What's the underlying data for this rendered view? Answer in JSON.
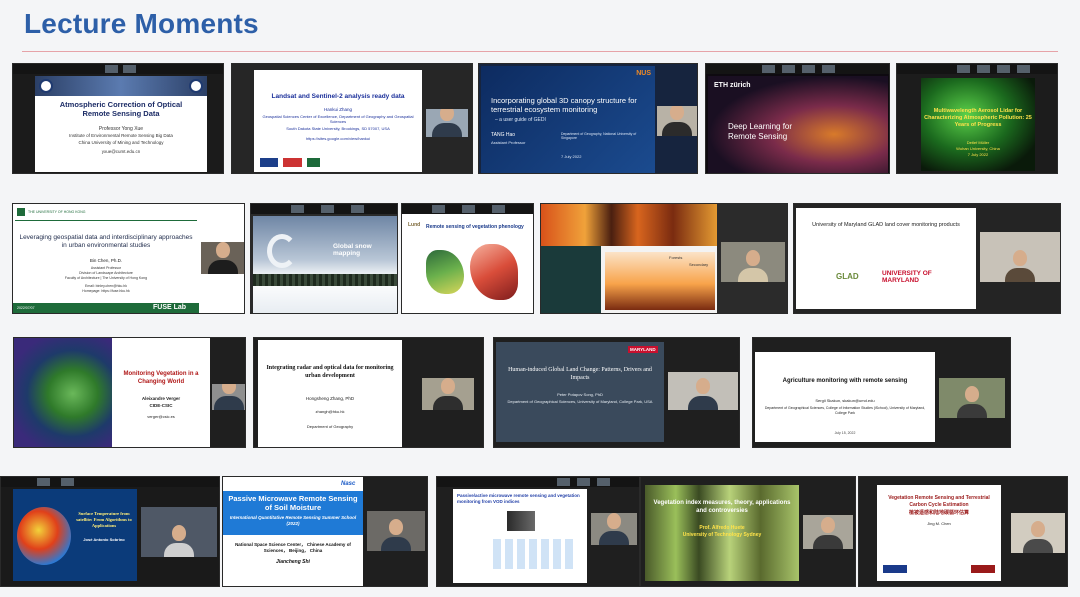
{
  "page": {
    "title": "Lecture Moments"
  },
  "row1": {
    "t1": {
      "title": "Atmospheric Correction of Optical Remote Sensing Data",
      "speaker": "Professor Yong Xue",
      "affiliation": "Institute of Environmental Remote Sensing Big Data",
      "institution": "China University of Mining and Technology",
      "email": "yxue@cumt.edu.cn"
    },
    "t2": {
      "title": "Landsat and Sentinel-2 analysis ready data",
      "speaker": "Hankui Zhang",
      "affiliation": "Geospatial Sciences Center of Excellence, Department of Geography and Geospatial Sciences",
      "institution": "South Dakota State University, Brookings, SD 57007, USA",
      "url": "https://sites.google.com/view/hankui"
    },
    "t3": {
      "logo": "NUS",
      "title": "Incorporating global 3D canopy structure for terrestrial ecosystem monitoring",
      "subtitle": "– a user guide of GEDI",
      "speaker": "TANG Hao",
      "role": "Assistant Professor",
      "affiliation": "Department of Geography, National University of Singapore",
      "date": "7 July 2022"
    },
    "t4": {
      "logo": "ETH zürich",
      "title": "Deep Learning for Remote Sensing"
    },
    "t5": {
      "title": "Multiwavelength Aerosol Lidar for Characterizing Atmospheric Pollution: 25 Years of Progress",
      "speaker": "Detlef Müller",
      "institution": "Wuhan University, China",
      "date": "7 July 2022"
    }
  },
  "row2": {
    "t1": {
      "university": "THE UNIVERSITY OF HONG KONG",
      "title": "Leveraging geospatial data and interdisciplinary approaches in urban environmental studies",
      "speaker": "Bin Chen, Ph.D.",
      "role": "Assistant Professor",
      "affiliation": "Division of Landscape Architecture",
      "faculty": "Faculty of Architecture | The University of Hong Kong",
      "email": "Email: binley.chen@hku.hk",
      "homepage": "Homepage: https://fuse.hku.hk",
      "lab": "FUSE Lab",
      "date": "2022/07/07"
    },
    "t2": {
      "title": "Global snow mapping"
    },
    "t3": {
      "title": "Remote sensing of vegetation phenology",
      "logo": "Lund"
    },
    "t4": {
      "label_left": "Forests",
      "label_right": "Secondary"
    },
    "t5": {
      "title": "University of Maryland GLAD land cover monitoring products",
      "logo_left": "GLAD",
      "logo_right": "UNIVERSITY OF MARYLAND"
    }
  },
  "row3": {
    "t1": {
      "title": "Monitoring Vegetation in a Changing World",
      "speaker": "Aleixandre Verger",
      "institution": "CIDE-CSIC",
      "email": "verger@csic.es"
    },
    "t2": {
      "title": "Integrating radar and optical data for monitoring urban development",
      "speaker": "Hongsheng Zhang, PhD",
      "email": "zhangh@hku.hk",
      "department": "Department of Geography"
    },
    "t3": {
      "logo": "MARYLAND",
      "title": "Human-induced Global Land Change: Patterns, Drivers and Impacts",
      "speaker": "Peter Potapov Song, PhD",
      "affiliation": "Department of Geographical Sciences, University of Maryland, College Park, USA"
    },
    "t4": {
      "title": "Agriculture monitoring with remote sensing",
      "speaker": "Sergii Skakun, skakun@umd.edu",
      "affiliation": "Department of Geographical Sciences, College of Information Studies (iSchool), University of Maryland, College Park",
      "date": "July 15, 2022"
    }
  },
  "row4": {
    "t1": {
      "title": "Surface Temperature from satellite: From Algorithms to Applications",
      "speaker": "José Antonio Sobrino"
    },
    "t2": {
      "logo": "Nasc",
      "title": "Passive Microwave Remote Sensing of Soil Moisture",
      "subtitle": "International Quantitative Remote Sensing Summer School (2022)",
      "institution": "National Space Science Center， Chinese Academy of Sciences， Beijing， China",
      "speaker": "Jiancheng Shi"
    },
    "t3": {
      "title": "Passive/active microwave remote sensing and vegetation monitoring from VOD indices"
    },
    "t4": {
      "title": "Vegetation index measures, theory, applications and controversies",
      "speaker": "Prof. Alfredo Huete",
      "institution": "University of Technology Sydney"
    },
    "t5": {
      "title": "Vegetation Remote Sensing and Terrestrial Carbon Cycle Estimation",
      "title_cn": "植被遥感和陆地碳循环估算",
      "speaker": "Jing M. Chen"
    }
  }
}
